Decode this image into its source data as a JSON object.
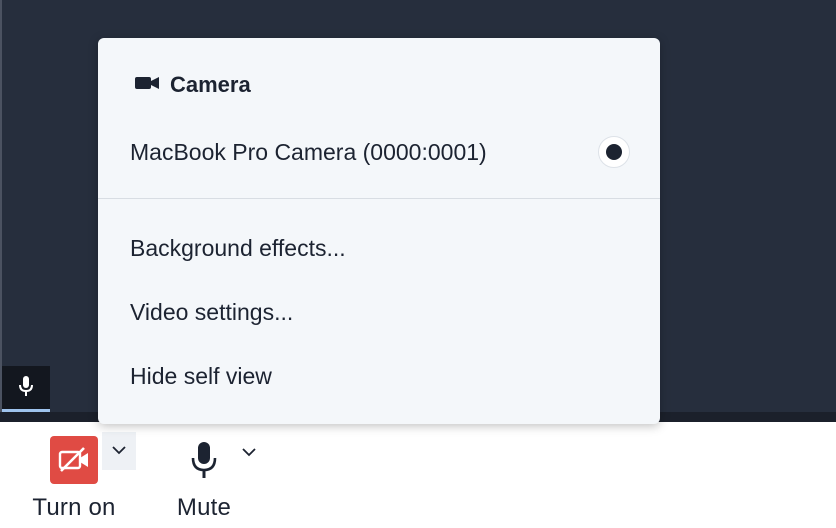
{
  "menu": {
    "title": "Camera",
    "title_icon": "video-camera-icon",
    "device": {
      "label": "MacBook Pro Camera (0000:0001)",
      "selected": true
    },
    "items": [
      {
        "label": "Background effects..."
      },
      {
        "label": "Video settings..."
      },
      {
        "label": "Hide self view"
      }
    ]
  },
  "toolbar": {
    "camera_button": {
      "label": "Turn on",
      "icon": "video-off-icon",
      "icon_color": "#e04b44"
    },
    "mute_button": {
      "label": "Mute",
      "icon": "microphone-icon"
    }
  },
  "self_view": {
    "indicator_icon": "microphone-icon"
  },
  "colors": {
    "background": "#262e3d",
    "menu_background": "#f4f7fa",
    "text": "#1c2331",
    "danger": "#e04b44",
    "accent": "#9fc4ee"
  }
}
